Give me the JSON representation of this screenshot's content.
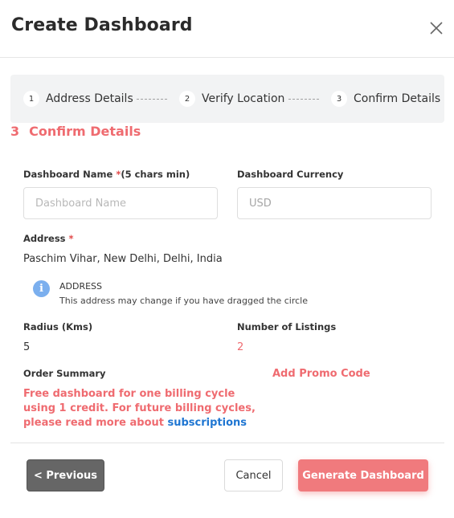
{
  "dialog": {
    "title": "Create Dashboard",
    "close_icon": "close-icon"
  },
  "stepper": {
    "steps": [
      {
        "number": "1",
        "label": "Address Details"
      },
      {
        "number": "2",
        "label": "Verify Location"
      },
      {
        "number": "3",
        "label": "Confirm Details"
      }
    ]
  },
  "section": {
    "number": "3",
    "title": "Confirm Details"
  },
  "form": {
    "dashboard_name": {
      "label": "Dashboard Name ",
      "required_mark": "*",
      "hint": "(5 chars min)",
      "value": "",
      "placeholder": "Dashboard Name"
    },
    "currency": {
      "label": "Dashboard Currency",
      "value": "USD"
    },
    "address": {
      "label": "Address ",
      "required_mark": "*",
      "value": "Paschim Vihar, New Delhi, Delhi, India"
    },
    "address_info": {
      "icon": "info-icon",
      "icon_glyph": "i",
      "title": "ADDRESS",
      "text": "This address may change if you have dragged the circle"
    },
    "radius": {
      "label": "Radius (Kms)",
      "value": "5"
    },
    "listings": {
      "label": "Number of Listings",
      "value": "2"
    },
    "order_summary": {
      "label": "Order Summary",
      "text": "Free dashboard for one billing cycle using 1 credit. For future billing cycles, please read more about ",
      "link": "subscriptions"
    },
    "promo_label": "Add Promo Code"
  },
  "footer": {
    "previous_label": "< Previous",
    "cancel_label": "Cancel",
    "generate_label": "Generate Dashboard"
  },
  "colors": {
    "accent": "#ef6b70",
    "link": "#1f76d2",
    "info": "#7bafee",
    "previous_button": "#666666"
  }
}
